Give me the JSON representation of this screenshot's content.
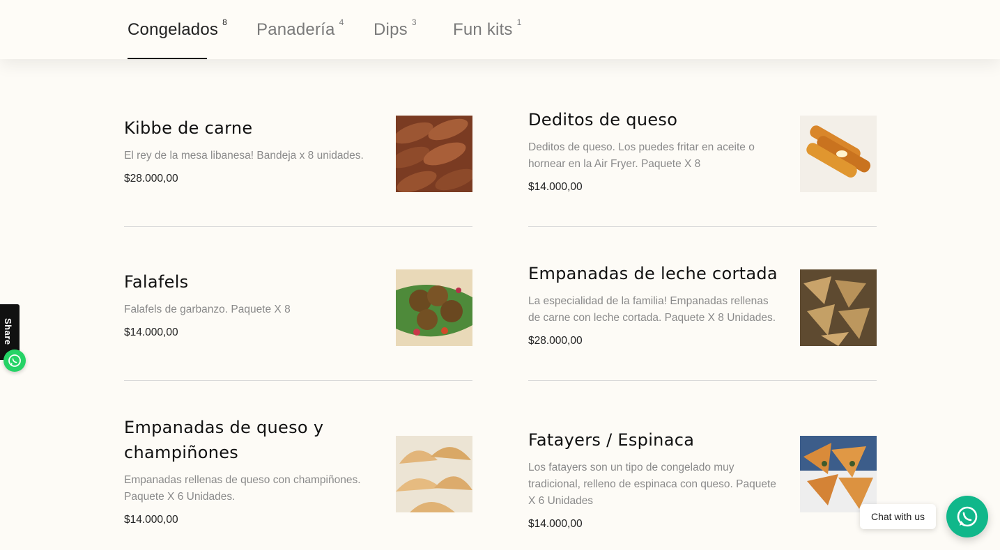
{
  "tabs": [
    {
      "label": "Congelados",
      "count": "8",
      "active": true
    },
    {
      "label": "Panadería",
      "count": "4",
      "active": false
    },
    {
      "label": "Dips",
      "count": "3",
      "active": false
    },
    {
      "label": "Fun kits",
      "count": "1",
      "active": false
    }
  ],
  "items": [
    {
      "title": "Kibbe de carne",
      "desc": "El rey de la mesa libanesa! Bandeja x 8 unidades.",
      "price": "$28.000,00",
      "image_icon": "kibbe-image"
    },
    {
      "title": "Deditos de queso",
      "desc": "Deditos de queso. Los puedes fritar en aceite o hornear en la Air Fryer.  Paquete X 8",
      "price": "$14.000,00",
      "image_icon": "deditos-image"
    },
    {
      "title": "Falafels",
      "desc": "Falafels de garbanzo.  Paquete X 8",
      "price": "$14.000,00",
      "image_icon": "falafel-image"
    },
    {
      "title": "Empanadas de leche cortada",
      "desc": "La especialidad de la familia! Empanadas rellenas de carne con leche cortada.  Paquete X 8 Unidades.",
      "price": "$28.000,00",
      "image_icon": "empanadas-leche-image"
    },
    {
      "title": "Empanadas de queso y champiñones",
      "desc": "Empanadas rellenas de queso con champiñones.  Paquete X 6 Unidades.",
      "price": "$14.000,00",
      "image_icon": "empanadas-queso-image"
    },
    {
      "title": "Fatayers / Espinaca",
      "desc": "Los fatayers son un tipo de congelado muy tradicional, relleno de espinaca con queso.  Paquete X 6 Unidades",
      "price": "$14.000,00",
      "image_icon": "fatayers-image"
    }
  ],
  "share": {
    "label": "Share"
  },
  "chat": {
    "label": "Chat with us"
  },
  "colors": {
    "background": "#fdfbf6",
    "whatsapp": "#25d366",
    "chat_button": "#10b78a"
  }
}
